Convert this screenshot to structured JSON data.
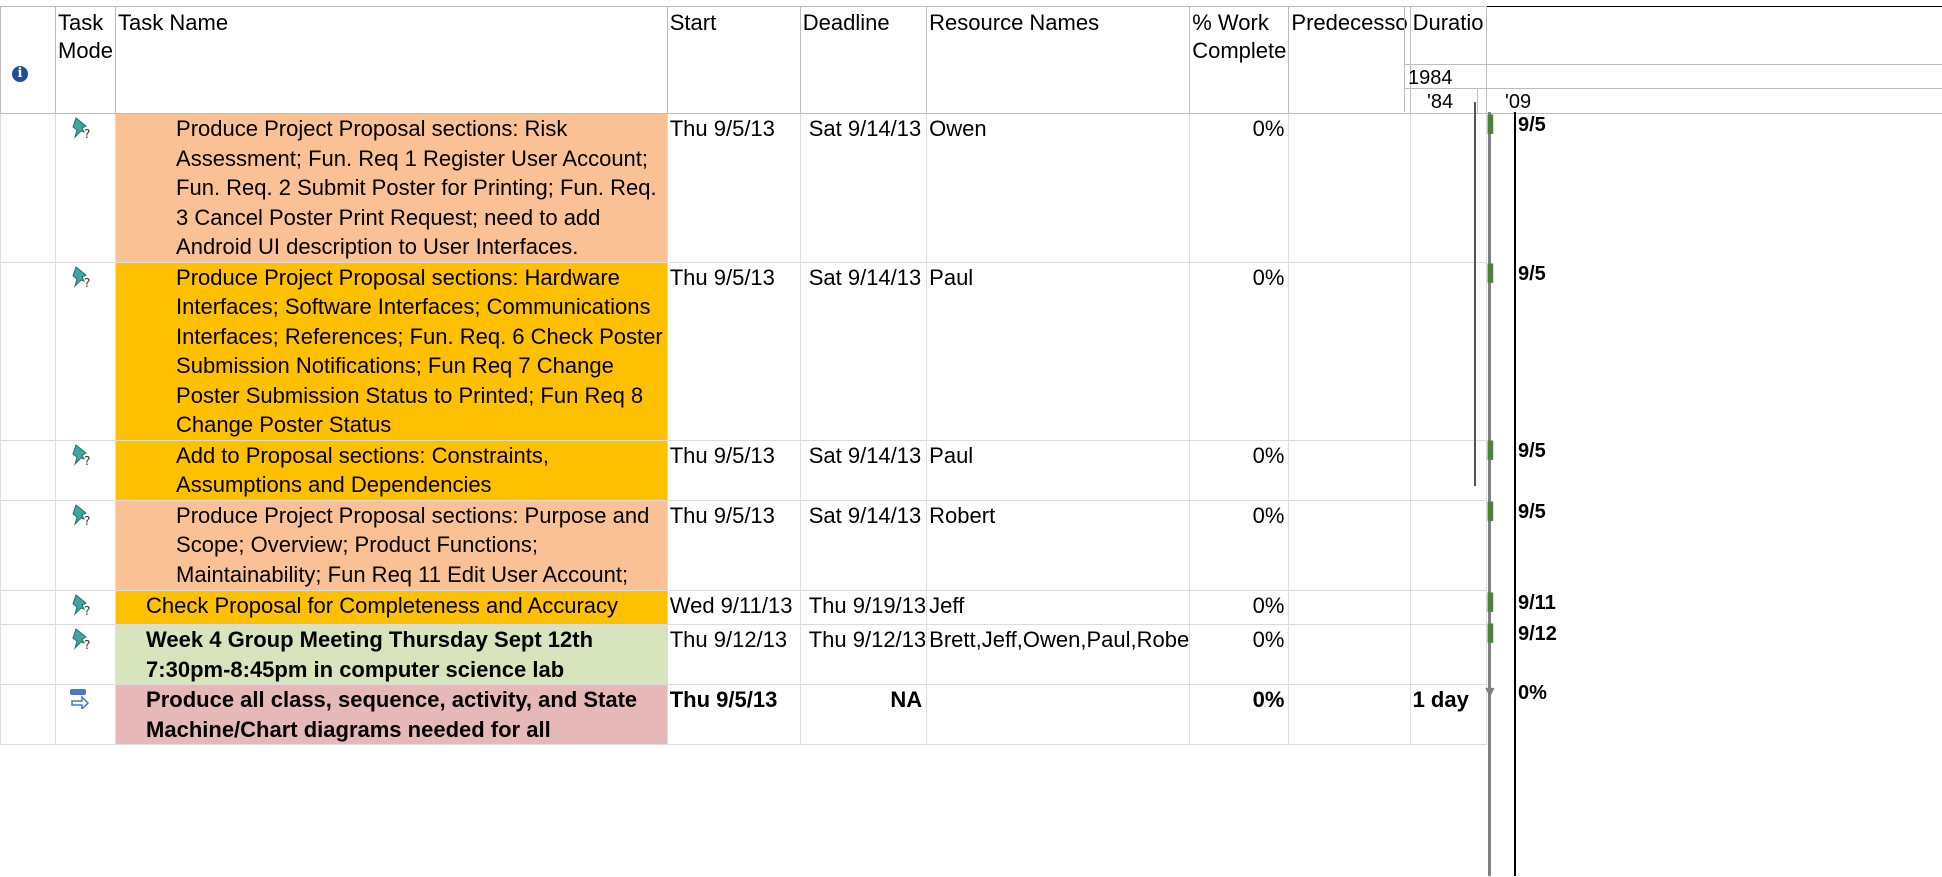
{
  "columns": {
    "task_mode": "Task Mode",
    "task_name": "Task Name",
    "start": "Start",
    "deadline": "Deadline",
    "resource_names": "Resource Names",
    "pct_work": "% Work Complete",
    "predecessors": "Predecesso",
    "duration": "Duratio"
  },
  "gantt_header": {
    "year": "1984",
    "tick1": "'84",
    "tick2": "'09"
  },
  "rows": [
    {
      "name": "Produce Project Proposal sections: Risk Assessment; Fun. Req 1 Register User Account; Fun. Req. 2 Submit Poster for Printing; Fun. Req. 3 Cancel Poster Print Request; need to add Android UI description to User Interfaces.",
      "name_lines": [
        "Produce Project Proposal sections: Risk",
        "Assessment; Fun. Req 1 Register User Account;",
        "Fun. Req. 2 Submit Poster for Printing; Fun. Req.",
        "3 Cancel Poster Print Request; need to add",
        "Android UI description to User Interfaces."
      ],
      "start": "Thu 9/5/13",
      "deadline": "Sat 9/14/13",
      "resources": "Owen",
      "pct": "0%",
      "predecessors": "",
      "duration": "",
      "gantt_label": "9/5",
      "mode_icon": "manual-pin-icon",
      "color": "#f9c194"
    },
    {
      "name": "Produce Project Proposal sections: Hardware Interfaces; Software Interfaces; Communications Interfaces; References; Fun. Req. 6 Check Poster Submission Notifications; Fun Req 7 Change Poster Submission Status to Printed; Fun Req 8 Change Poster Status",
      "name_lines": [
        "Produce Project Proposal sections: Hardware",
        "Interfaces; Software Interfaces; Communications",
        "Interfaces; References; Fun. Req. 6 Check Poster",
        "Submission Notifications; Fun Req 7 Change",
        "Poster Submission Status to Printed; Fun Req 8",
        "Change Poster Status"
      ],
      "start": "Thu 9/5/13",
      "deadline": "Sat 9/14/13",
      "resources": "Paul",
      "pct": "0%",
      "predecessors": "",
      "duration": "",
      "gantt_label": "9/5",
      "mode_icon": "manual-pin-icon",
      "color": "#ffc000"
    },
    {
      "name": "Add to Proposal sections: Constraints, Assumptions and Dependencies",
      "name_lines": [
        "Add to Proposal sections: Constraints,",
        "Assumptions and Dependencies"
      ],
      "start": "Thu 9/5/13",
      "deadline": "Sat 9/14/13",
      "resources": "Paul",
      "pct": "0%",
      "predecessors": "",
      "duration": "",
      "gantt_label": "9/5",
      "mode_icon": "manual-pin-icon",
      "color": "#ffc000"
    },
    {
      "name": "Produce Project Proposal sections: Purpose and Scope; Overview; Product Functions; Maintainability; Fun Req 11 Edit User Account;",
      "name_lines": [
        "Produce Project Proposal sections: Purpose and",
        "Scope; Overview; Product Functions;",
        "Maintainability; Fun Req 11 Edit User Account;"
      ],
      "start": "Thu 9/5/13",
      "deadline": "Sat 9/14/13",
      "resources": "Robert",
      "pct": "0%",
      "predecessors": "",
      "duration": "",
      "gantt_label": "9/5",
      "mode_icon": "manual-pin-icon",
      "color": "#f9c194"
    },
    {
      "name": "Check Proposal for Completeness and Accuracy",
      "name_lines": [
        "Check Proposal for Completeness and Accuracy"
      ],
      "start": "Wed 9/11/13",
      "deadline": "Thu 9/19/13",
      "resources": "Jeff",
      "pct": "0%",
      "predecessors": "",
      "duration": "",
      "gantt_label": "9/11",
      "mode_icon": "manual-pin-icon",
      "color": "#ffc000"
    },
    {
      "name": "Week 4 Group Meeting Thursday Sept 12th 7:30pm-8:45pm in computer science lab",
      "name_lines": [
        "Week 4 Group Meeting Thursday Sept 12th",
        "7:30pm-8:45pm in computer science lab"
      ],
      "start": "Thu 9/12/13",
      "deadline": "Thu 9/12/13",
      "resources": "Brett,Jeff,Owen,Paul,Robe",
      "pct": "0%",
      "predecessors": "",
      "duration": "",
      "gantt_label": "9/12",
      "mode_icon": "manual-pin-icon",
      "color": "#d8e4bc"
    },
    {
      "name": "Produce all class, sequence, activity, and State Machine/Chart diagrams needed for all",
      "name_lines": [
        "Produce all class, sequence, activity, and State",
        "Machine/Chart diagrams needed for all"
      ],
      "start": "Thu 9/5/13",
      "deadline": "NA",
      "resources": "",
      "pct": "0%",
      "predecessors": "",
      "duration": "1 day",
      "gantt_label": "0%",
      "mode_icon": "auto-schedule-icon",
      "color": "#e6b8b7"
    }
  ]
}
